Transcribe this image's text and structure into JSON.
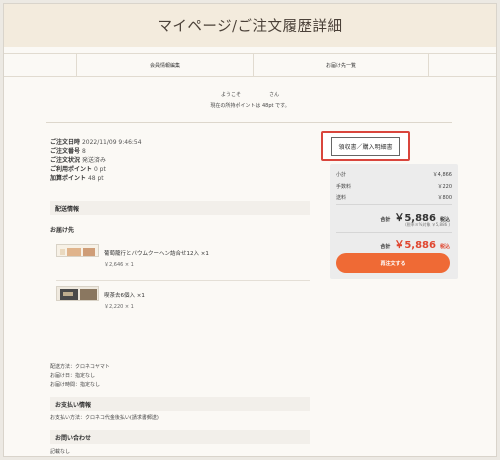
{
  "page_title": "マイページ/ご注文履歴詳細",
  "subnav": [
    "",
    "会員情報編集",
    "お届け先一覧",
    ""
  ],
  "welcome": {
    "prefix": "ようこそ",
    "suffix": "さん",
    "points_line": "現在の所持ポイントは 48pt です。"
  },
  "order_meta": [
    {
      "label": "ご注文日時",
      "value": "2022/11/09 9:46:54"
    },
    {
      "label": "ご注文番号",
      "value": "8"
    },
    {
      "label": "ご注文状況",
      "value": "発送済み"
    },
    {
      "label": "ご利用ポイント",
      "value": "0 pt"
    },
    {
      "label": "加算ポイント",
      "value": "48 pt"
    }
  ],
  "sections": {
    "delivery": "配送情報",
    "deliver_to": "お届け先",
    "payment": "お支払い情報",
    "inquiry": "お問い合わせ"
  },
  "items": [
    {
      "name": "葡萄籠行とバウムクーヘン詰合せ12入 ×1",
      "price": "￥2,646 × 1"
    },
    {
      "name": "喫茶去6個入 ×1",
      "price": "￥2,220 × 1"
    }
  ],
  "shipping_info": [
    "配送方法：クロネコヤマト",
    "お届け日：指定なし",
    "お届け時間：指定なし"
  ],
  "payment_info": "お支払い方法：クロネコ代金後払い(請求書郵送)",
  "inquiry_text": "記載なし",
  "receipt_button": "領収書／購入明細書",
  "summary": {
    "subtotal_label": "小計",
    "subtotal": "￥4,866",
    "fee_label": "手数料",
    "fee": "￥220",
    "shipping_label": "送料",
    "shipping": "￥800",
    "total_label": "合計",
    "total": "￥5,886",
    "tax_label": "税込",
    "tax_note": "(税率８%対象 ￥5,886 )",
    "grand_label": "合計",
    "grand_total": "￥5,886",
    "grand_tax": "税込",
    "pay_button": "再注文する"
  },
  "colors": {
    "accent_red": "#d9453c",
    "pay_orange": "#ef6a35",
    "hero_bg": "#f3ebdd"
  }
}
